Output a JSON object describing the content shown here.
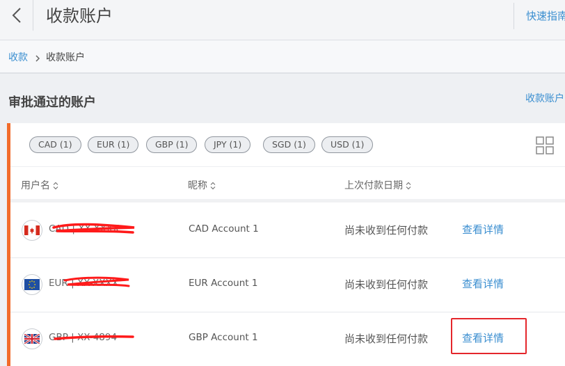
{
  "header": {
    "title": "收款账户",
    "quick_guide": "快速指南"
  },
  "breadcrumb": {
    "parent": "收款",
    "current": "收款账户"
  },
  "section": {
    "title": "审批通过的账户",
    "right_link": "收款账户"
  },
  "currency_filters": [
    {
      "label": "CAD (1)"
    },
    {
      "label": "EUR (1)"
    },
    {
      "label": "GBP (1)"
    },
    {
      "label": "JPY (1)"
    },
    {
      "label": "SGD (1)"
    },
    {
      "label": "USD (1)"
    }
  ],
  "table": {
    "columns": [
      "用户名",
      "昵称",
      "上次付款日期"
    ],
    "rows": [
      {
        "flag": "canada-flag-icon",
        "account": "CAD | XX-XXXX",
        "nickname": "CAD Account 1",
        "status": "尚未收到任何付款",
        "action": "查看详情"
      },
      {
        "flag": "eu-flag-icon",
        "account": "EUR | XX-XXXX",
        "nickname": "EUR Account 1",
        "status": "尚未收到任何付款",
        "action": "查看详情"
      },
      {
        "flag": "uk-flag-icon",
        "account": "GBP | XX-4894",
        "nickname": "GBP Account 1",
        "status": "尚未收到任何付款",
        "action": "查看详情"
      }
    ]
  },
  "colors": {
    "accent_blue": "#3a8ed0",
    "panel_border": "#f26b2a",
    "annotation_red": "#e4262b"
  }
}
